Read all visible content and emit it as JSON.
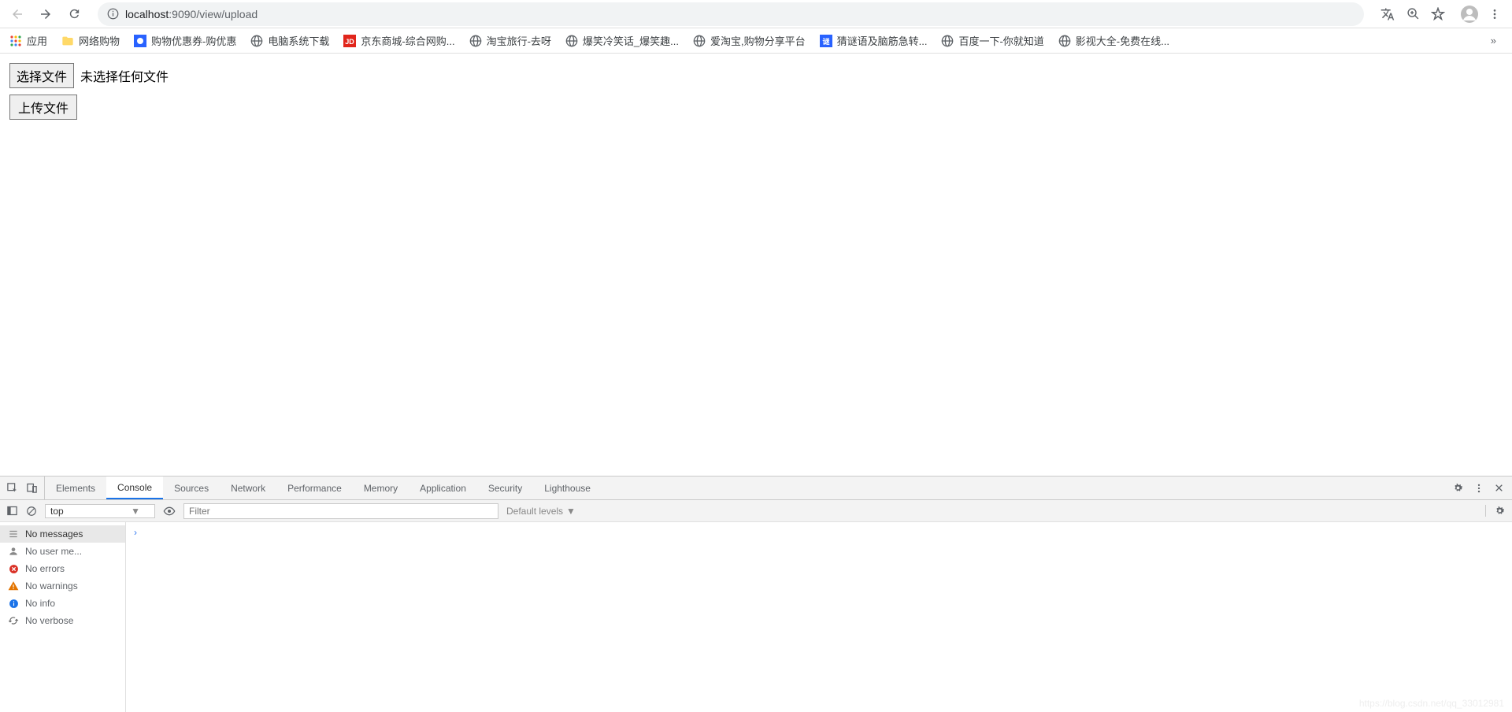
{
  "browser": {
    "url_host": "localhost",
    "url_port": ":9090",
    "url_path": "/view/upload"
  },
  "bookmarks": {
    "apps": "应用",
    "items": [
      {
        "label": "网络购物",
        "icon": "folder"
      },
      {
        "label": "购物优惠券-购优惠",
        "icon": "blue"
      },
      {
        "label": "电脑系统下载",
        "icon": "globe"
      },
      {
        "label": "京东商城-综合网购...",
        "icon": "jd"
      },
      {
        "label": "淘宝旅行-去呀",
        "icon": "globe"
      },
      {
        "label": "爆笑冷笑话_爆笑趣...",
        "icon": "globe"
      },
      {
        "label": "爱淘宝,购物分享平台",
        "icon": "globe"
      },
      {
        "label": "猜谜语及脑筋急转...",
        "icon": "mi"
      },
      {
        "label": "百度一下-你就知道",
        "icon": "globe"
      },
      {
        "label": "影视大全-免费在线...",
        "icon": "globe"
      }
    ],
    "overflow": "»"
  },
  "page": {
    "choose_file_label": "选择文件",
    "no_file_text": "未选择任何文件",
    "upload_label": "上传文件"
  },
  "devtools": {
    "tabs": [
      "Elements",
      "Console",
      "Sources",
      "Network",
      "Performance",
      "Memory",
      "Application",
      "Security",
      "Lighthouse"
    ],
    "active_tab": "Console",
    "context": "top",
    "filter_placeholder": "Filter",
    "levels": "Default levels",
    "sidebar": [
      {
        "icon": "list",
        "label": "No messages"
      },
      {
        "icon": "user",
        "label": "No user me..."
      },
      {
        "icon": "error",
        "label": "No errors"
      },
      {
        "icon": "warn",
        "label": "No warnings"
      },
      {
        "icon": "info",
        "label": "No info"
      },
      {
        "icon": "verbose",
        "label": "No verbose"
      }
    ],
    "prompt": "›"
  },
  "watermark": "https://blog.csdn.net/qq_33012981"
}
